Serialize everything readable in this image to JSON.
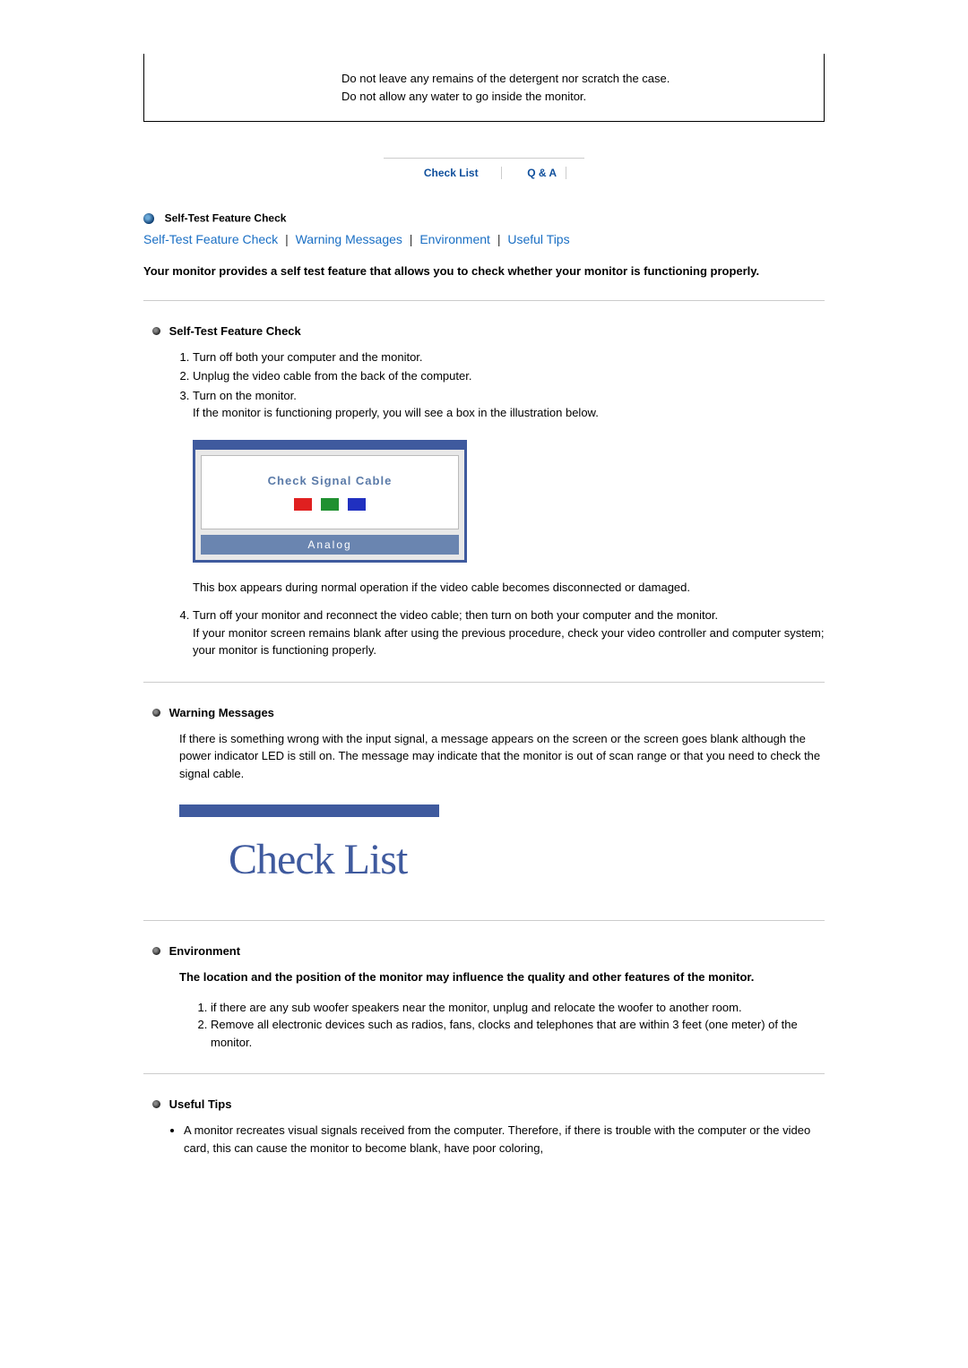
{
  "warning": {
    "line1": "Do not leave any remains of the detergent nor scratch the case.",
    "line2": "Do not allow any water to go inside the monitor."
  },
  "tabs": {
    "check_list": "Check List",
    "qa": "Q & A"
  },
  "top_section_title": "Self-Test Feature Check",
  "anchors": {
    "a1": "Self-Test Feature Check",
    "a2": "Warning Messages",
    "a3": "Environment",
    "a4": "Useful Tips"
  },
  "intro": "Your monitor provides a self test feature that allows you to check whether your monitor is functioning properly.",
  "self_test": {
    "heading": "Self-Test Feature Check",
    "step1": "Turn off both your computer and the monitor.",
    "step2": "Unplug the video cable from the back of the computer.",
    "step3a": "Turn on the monitor.",
    "step3b": "If the monitor is functioning properly, you will see a box in the illustration below.",
    "monitor_msg": "Check Signal Cable",
    "monitor_mode": "Analog",
    "after_box": "This box appears during normal operation if the video cable becomes disconnected or damaged.",
    "step4a": "Turn off your monitor and reconnect the video cable; then turn on both your computer and the monitor.",
    "step4b": "If your monitor screen remains blank after using the previous procedure, check your video controller and computer system; your monitor is functioning properly."
  },
  "warning_section": {
    "heading": "Warning Messages",
    "body": "If there is something wrong with the input signal, a message appears on the screen or the screen goes blank although the power indicator LED is still on. The message may indicate that the monitor is out of scan range or that you need to check the signal cable.",
    "banner_text": "Check List"
  },
  "environment": {
    "heading": "Environment",
    "bold": "The location and the position of the monitor may influence the quality and other features of the monitor.",
    "item1": "if there are any sub woofer speakers near the monitor, unplug and relocate the woofer to another room.",
    "item2": "Remove all electronic devices such as radios, fans, clocks and telephones that are within 3 feet (one meter) of the monitor."
  },
  "tips": {
    "heading": "Useful Tips",
    "item1": "A monitor recreates visual signals received from the computer. Therefore, if there is trouble with the computer or the video card, this can cause the monitor to become blank, have poor coloring,"
  }
}
